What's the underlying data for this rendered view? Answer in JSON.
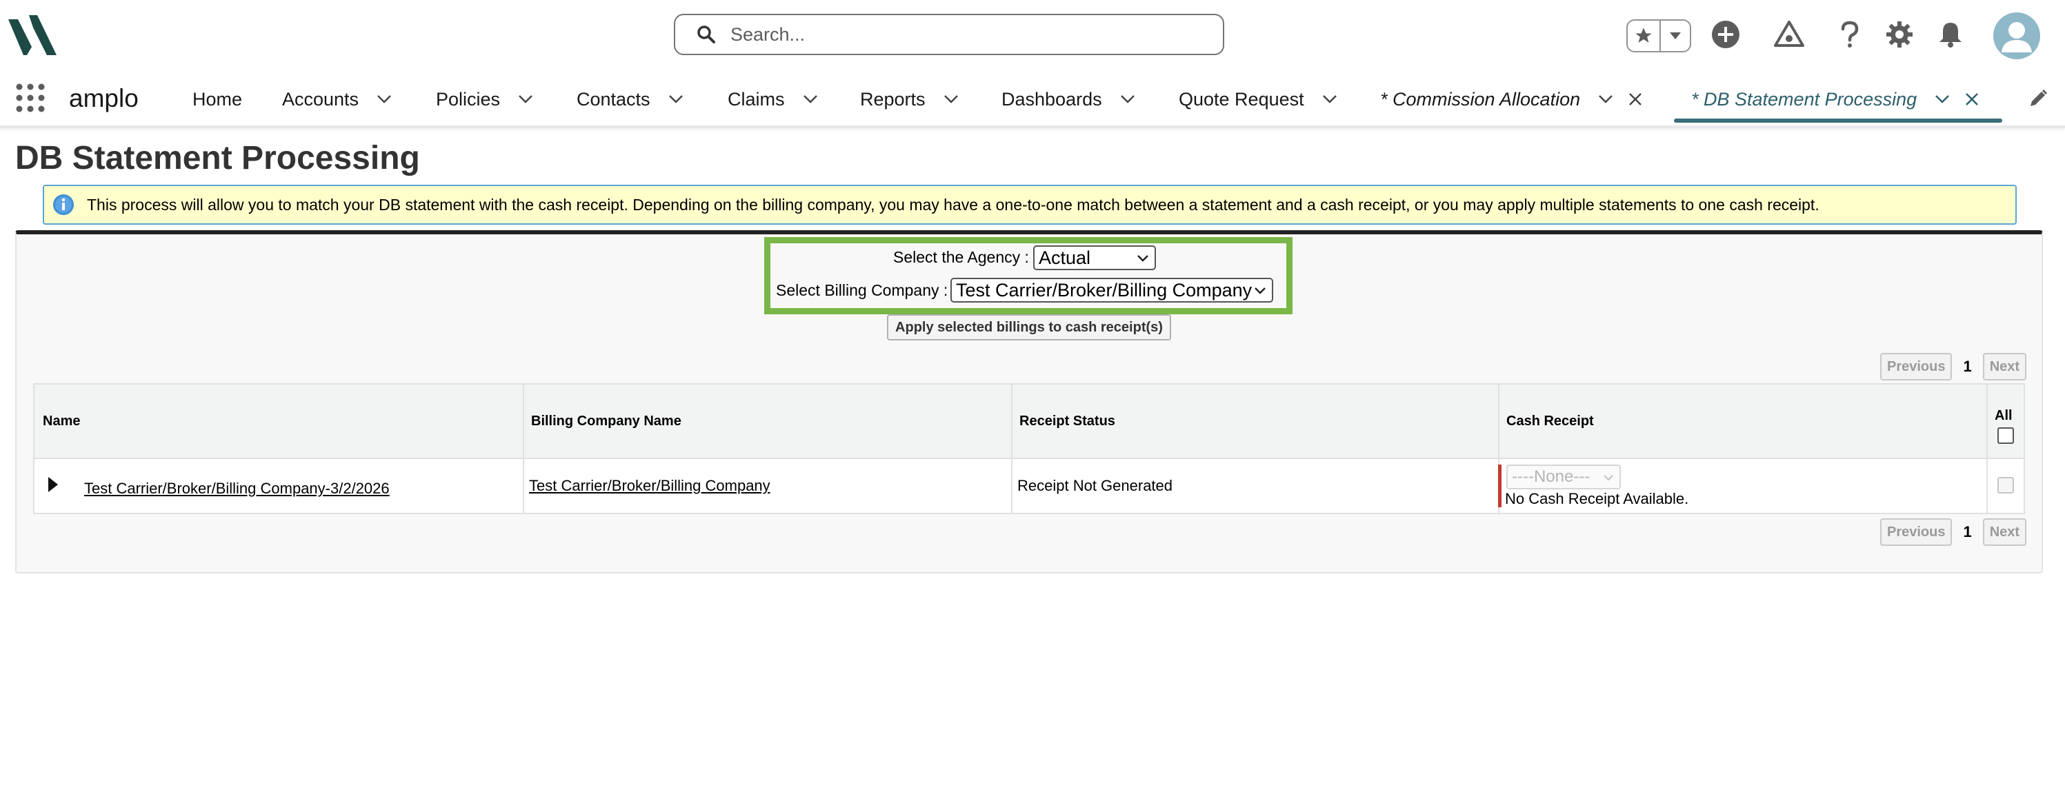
{
  "header": {
    "search_placeholder": "Search...",
    "icons": [
      "app-logo",
      "search-icon",
      "star-icon",
      "chevron-down-icon",
      "add-icon",
      "trailhead-icon",
      "help-icon",
      "setup-gear-icon",
      "bell-icon",
      "user-avatar-icon"
    ]
  },
  "nav": {
    "app_name": "amplo",
    "items": [
      {
        "label": "Home"
      },
      {
        "label": "Accounts"
      },
      {
        "label": "Policies"
      },
      {
        "label": "Contacts"
      },
      {
        "label": "Claims"
      },
      {
        "label": "Reports"
      },
      {
        "label": "Dashboards"
      },
      {
        "label": "Quote Request"
      }
    ],
    "tabs": [
      {
        "label": "* Commission Allocation",
        "active": false
      },
      {
        "label": "* DB Statement Processing",
        "active": true
      }
    ],
    "accent_color": "#3a6e79"
  },
  "page": {
    "title": "DB Statement Processing",
    "info_message": "This process will allow you to match your DB statement with the cash receipt. Depending on the billing company, you may have a one-to-one match between a statement and a cash receipt, or you may apply multiple statements to one cash receipt.",
    "agency_label": "Select the Agency :",
    "agency_value": "Actual",
    "billing_label": "Select Billing Company :",
    "billing_value": "Test Carrier/Broker/Billing Company",
    "apply_button": "Apply selected billings to cash receipt(s)",
    "highlight_color": "#7ab648"
  },
  "pagination": {
    "previous": "Previous",
    "page": "1",
    "next": "Next"
  },
  "table": {
    "headers": {
      "name": "Name",
      "billing_company": "Billing Company Name",
      "receipt_status": "Receipt Status",
      "cash_receipt": "Cash Receipt",
      "all": "All"
    },
    "rows": [
      {
        "name": "Test Carrier/Broker/Billing Company-3/2/2026",
        "billing_company": "Test Carrier/Broker/Billing Company",
        "receipt_status": "Receipt Not Generated",
        "cash_receipt_select": "----None---",
        "cash_receipt_note": "No Cash Receipt Available."
      }
    ]
  }
}
